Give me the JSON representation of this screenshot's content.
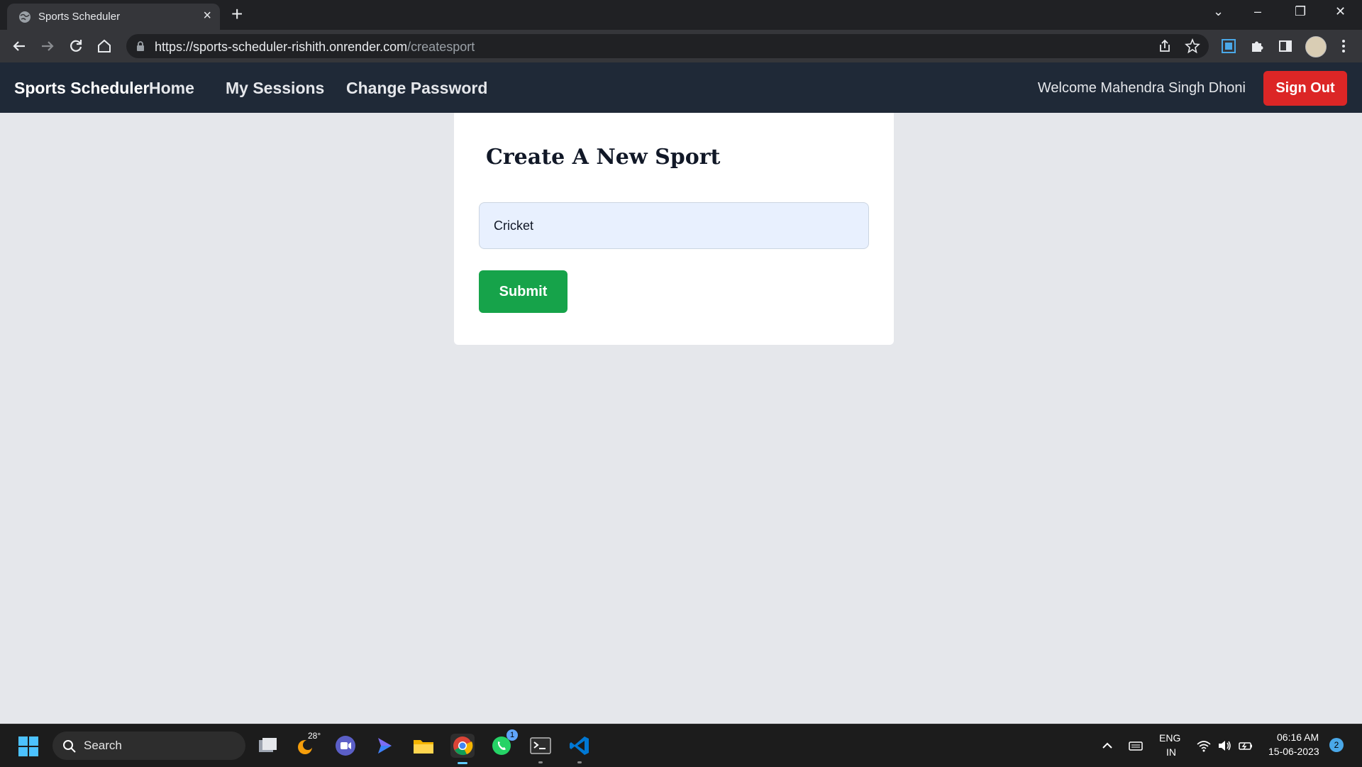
{
  "browser": {
    "tab_title": "Sports Scheduler",
    "new_tab_label": "+",
    "url_host": "https://sports-scheduler-rishith.onrender.com",
    "url_path": "/createsport"
  },
  "navbar": {
    "brand": "Sports Scheduler",
    "links": [
      "Home",
      "My Sessions",
      "Change Password"
    ],
    "welcome": "Welcome Mahendra Singh Dhoni",
    "sign_out": "Sign Out"
  },
  "form": {
    "title": "Create A New Sport",
    "sport_value": "Cricket",
    "submit_label": "Submit"
  },
  "taskbar": {
    "search_label": "Search",
    "weather_temp": "28°",
    "whatsapp_badge": "1",
    "language": "ENG",
    "region": "IN",
    "time": "06:16 AM",
    "date": "15-06-2023",
    "notifications": "2"
  },
  "colors": {
    "navbar_bg": "#1f2937",
    "page_bg": "#e5e7eb",
    "sign_out": "#dc2626",
    "submit": "#16a34a"
  }
}
